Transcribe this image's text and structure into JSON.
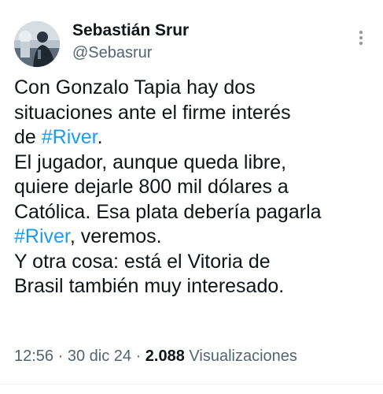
{
  "tweet": {
    "author": {
      "name": "Sebastián Srur",
      "handle": "@Sebasrur"
    },
    "body": {
      "line1": "Con Gonzalo Tapia hay dos",
      "line2": "situaciones ante el firme interés",
      "line3_prefix": "de ",
      "line3_hashtag": "#River",
      "line3_suffix": ".",
      "line4": "El jugador, aunque queda libre,",
      "line5": "quiere dejarle 800 mil dólares a",
      "line6": "Católica. Esa plata debería pagarla",
      "line7_hashtag": "#River",
      "line7_suffix": ", veremos.",
      "line8": "Y otra cosa: está el Vitoria de",
      "line9": "Brasil también muy interesado."
    },
    "meta": {
      "time": "12:56",
      "separator1": " · ",
      "date": "30 dic 24",
      "separator2": " · ",
      "views_count": "2.088",
      "views_label": " Visualizaciones"
    }
  },
  "icons": {
    "more": "more-dots-vertical-icon",
    "avatar": "user-avatar-photo"
  }
}
